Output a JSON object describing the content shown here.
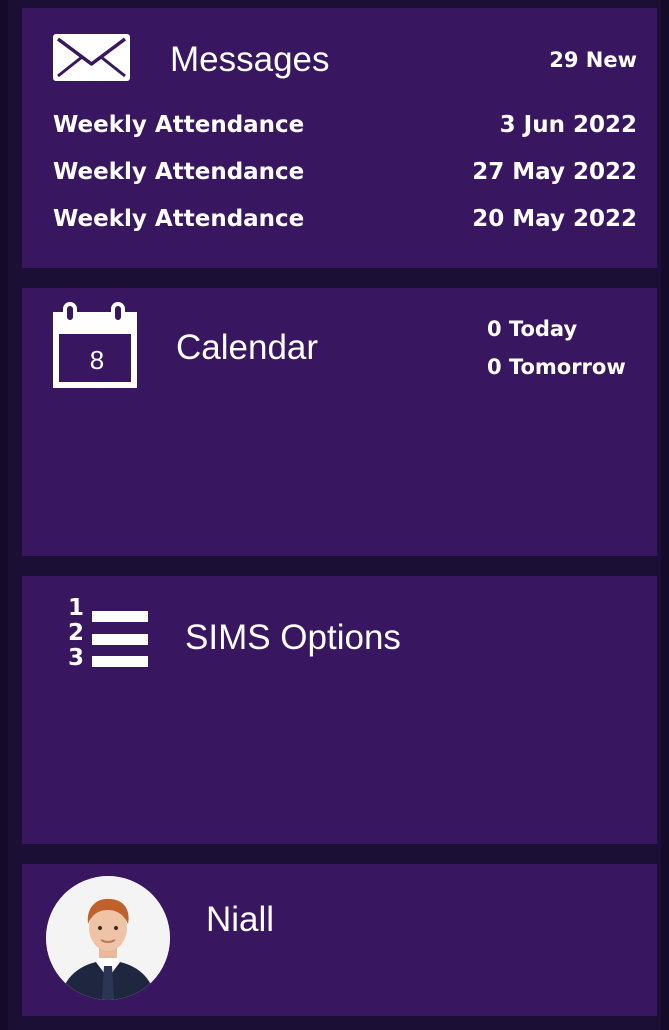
{
  "colors": {
    "background": "#1c0f35",
    "tile": "#381660",
    "text": "#ffffff"
  },
  "messages": {
    "icon": "envelope-icon",
    "title": "Messages",
    "new_count": "29 New",
    "items": [
      {
        "subject": "Weekly Attendance",
        "date": "3 Jun 2022"
      },
      {
        "subject": "Weekly Attendance",
        "date": "27 May 2022"
      },
      {
        "subject": "Weekly Attendance",
        "date": "20 May 2022"
      }
    ]
  },
  "calendar": {
    "icon": "calendar-icon",
    "icon_day": "8",
    "title": "Calendar",
    "today": "0 Today",
    "tomorrow": "0 Tomorrow"
  },
  "sims": {
    "icon": "numbered-list-icon",
    "title": "SIMS Options",
    "list_numbers": [
      "1",
      "2",
      "3"
    ]
  },
  "profile": {
    "avatar": "student-avatar",
    "name": "Niall"
  }
}
